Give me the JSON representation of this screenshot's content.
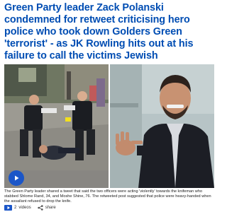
{
  "article": {
    "headline": "Green Party leader Zack Polanski condemned for retweet criticising hero police who took down Golders Green 'terrorist' - as JK Rowling hits out at his failure to call the victims Jewish",
    "caption": "The Green Party leader shared a tweet that said the two officers were acting 'violently' towards the knifeman who stabbed Shlome Rand, 34, and Moshe Shine, 76. The retweeted post suggested that police were heavy-handed when the assailant refused to drop the knife.",
    "videos_count": "2",
    "videos_label": "videos",
    "share_label": "share"
  },
  "colors": {
    "headline": "#004db3",
    "accent": "#1b56c8"
  },
  "icons": {
    "play": "play-icon",
    "video": "video-icon",
    "share": "share-icon"
  }
}
